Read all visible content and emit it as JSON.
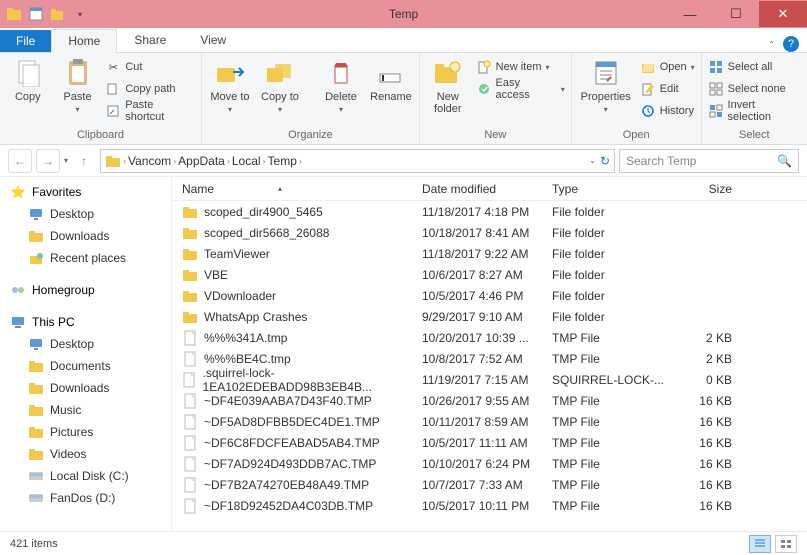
{
  "window": {
    "title": "Temp"
  },
  "tabs": {
    "file": "File",
    "home": "Home",
    "share": "Share",
    "view": "View"
  },
  "ribbon": {
    "clipboard": {
      "label": "Clipboard",
      "copy": "Copy",
      "paste": "Paste",
      "cut": "Cut",
      "copypath": "Copy path",
      "pasteshortcut": "Paste shortcut"
    },
    "organize": {
      "label": "Organize",
      "moveto": "Move to",
      "copyto": "Copy to",
      "delete": "Delete",
      "rename": "Rename"
    },
    "new": {
      "label": "New",
      "newfolder": "New folder",
      "newitem": "New item",
      "easyaccess": "Easy access"
    },
    "open": {
      "label": "Open",
      "properties": "Properties",
      "open": "Open",
      "edit": "Edit",
      "history": "History"
    },
    "select": {
      "label": "Select",
      "all": "Select all",
      "none": "Select none",
      "invert": "Invert selection"
    }
  },
  "breadcrumb": [
    "Vancom",
    "AppData",
    "Local",
    "Temp"
  ],
  "refresh": "↻",
  "search": {
    "placeholder": "Search Temp"
  },
  "columns": {
    "name": "Name",
    "date": "Date modified",
    "type": "Type",
    "size": "Size"
  },
  "sidebar": {
    "favorites": {
      "label": "Favorites",
      "items": [
        {
          "label": "Desktop",
          "icon": "desktop"
        },
        {
          "label": "Downloads",
          "icon": "folder"
        },
        {
          "label": "Recent places",
          "icon": "recent"
        }
      ]
    },
    "homegroup": {
      "label": "Homegroup"
    },
    "thispc": {
      "label": "This PC",
      "items": [
        {
          "label": "Desktop",
          "icon": "desktop"
        },
        {
          "label": "Documents",
          "icon": "folder"
        },
        {
          "label": "Downloads",
          "icon": "folder"
        },
        {
          "label": "Music",
          "icon": "folder"
        },
        {
          "label": "Pictures",
          "icon": "folder"
        },
        {
          "label": "Videos",
          "icon": "folder"
        },
        {
          "label": "Local Disk (C:)",
          "icon": "disk"
        },
        {
          "label": "FanDos (D:)",
          "icon": "disk"
        }
      ]
    }
  },
  "files": [
    {
      "name": "scoped_dir4900_5465",
      "date": "11/18/2017 4:18 PM",
      "type": "File folder",
      "size": "",
      "icon": "folder"
    },
    {
      "name": "scoped_dir5668_26088",
      "date": "10/18/2017 8:41 AM",
      "type": "File folder",
      "size": "",
      "icon": "folder"
    },
    {
      "name": "TeamViewer",
      "date": "11/18/2017 9:22 AM",
      "type": "File folder",
      "size": "",
      "icon": "folder"
    },
    {
      "name": "VBE",
      "date": "10/6/2017 8:27 AM",
      "type": "File folder",
      "size": "",
      "icon": "folder"
    },
    {
      "name": "VDownloader",
      "date": "10/5/2017 4:46 PM",
      "type": "File folder",
      "size": "",
      "icon": "folder"
    },
    {
      "name": "WhatsApp Crashes",
      "date": "9/29/2017 9:10 AM",
      "type": "File folder",
      "size": "",
      "icon": "folder"
    },
    {
      "name": "%%%341A.tmp",
      "date": "10/20/2017 10:39 ...",
      "type": "TMP File",
      "size": "2 KB",
      "icon": "file"
    },
    {
      "name": "%%%BE4C.tmp",
      "date": "10/8/2017 7:52 AM",
      "type": "TMP File",
      "size": "2 KB",
      "icon": "file"
    },
    {
      "name": ".squirrel-lock-1EA102EDEBADD98B3EB4B...",
      "date": "11/19/2017 7:15 AM",
      "type": "SQUIRREL-LOCK-...",
      "size": "0 KB",
      "icon": "file"
    },
    {
      "name": "~DF4E039AABA7D43F40.TMP",
      "date": "10/26/2017 9:55 AM",
      "type": "TMP File",
      "size": "16 KB",
      "icon": "file"
    },
    {
      "name": "~DF5AD8DFBB5DEC4DE1.TMP",
      "date": "10/11/2017 8:59 AM",
      "type": "TMP File",
      "size": "16 KB",
      "icon": "file"
    },
    {
      "name": "~DF6C8FDCFEABAD5AB4.TMP",
      "date": "10/5/2017 11:11 AM",
      "type": "TMP File",
      "size": "16 KB",
      "icon": "file"
    },
    {
      "name": "~DF7AD924D493DDB7AC.TMP",
      "date": "10/10/2017 6:24 PM",
      "type": "TMP File",
      "size": "16 KB",
      "icon": "file"
    },
    {
      "name": "~DF7B2A74270EB48A49.TMP",
      "date": "10/7/2017 7:33 AM",
      "type": "TMP File",
      "size": "16 KB",
      "icon": "file"
    },
    {
      "name": "~DF18D92452DA4C03DB.TMP",
      "date": "10/5/2017 10:11 PM",
      "type": "TMP File",
      "size": "16 KB",
      "icon": "file"
    }
  ],
  "status": {
    "count": "421 items"
  }
}
